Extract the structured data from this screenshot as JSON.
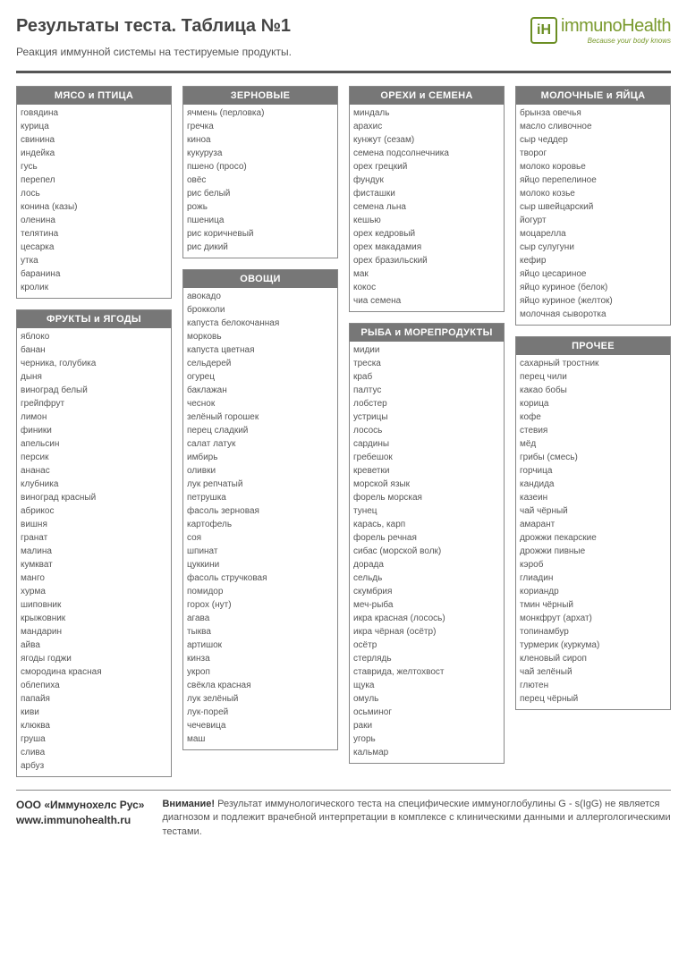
{
  "header": {
    "title": "Результаты теста. Таблица №1",
    "subtitle": "Реакция иммунной системы на тестируемые продукты."
  },
  "logo": {
    "name": "immunoHealth",
    "tagline": "Because your body knows"
  },
  "categories": {
    "meat": {
      "title": "МЯСО и ПТИЦА",
      "items": [
        "говядина",
        "курица",
        "свинина",
        "индейка",
        "гусь",
        "перепел",
        "лось",
        "конина (казы)",
        "оленина",
        "телятина",
        "цесарка",
        "утка",
        "баранина",
        "кролик"
      ]
    },
    "fruits": {
      "title": "ФРУКТЫ и ЯГОДЫ",
      "items": [
        "яблоко",
        "банан",
        "черника, голубика",
        "дыня",
        "виноград белый",
        "грейпфрут",
        "лимон",
        "финики",
        "апельсин",
        "персик",
        "ананас",
        "клубника",
        "виноград красный",
        "абрикос",
        "вишня",
        "гранат",
        "малина",
        "кумкват",
        "манго",
        "хурма",
        "шиповник",
        "крыжовник",
        "мандарин",
        "айва",
        "ягоды годжи",
        "смородина красная",
        "облепиха",
        "папайя",
        "киви",
        "клюква",
        "груша",
        "слива",
        "арбуз"
      ]
    },
    "grains": {
      "title": "ЗЕРНОВЫЕ",
      "items": [
        "ячмень (перловка)",
        "гречка",
        "киноа",
        "кукуруза",
        "пшено (просо)",
        "овёс",
        "рис белый",
        "рожь",
        "пшеница",
        "рис коричневый",
        "рис дикий"
      ]
    },
    "veg": {
      "title": "ОВОЩИ",
      "items": [
        "авокадо",
        "брокколи",
        "капуста белокочанная",
        "морковь",
        "капуста цветная",
        "сельдерей",
        "огурец",
        "баклажан",
        "чеснок",
        "зелёный горошек",
        "перец сладкий",
        "салат латук",
        "имбирь",
        "оливки",
        "лук репчатый",
        "петрушка",
        "фасоль зерновая",
        "картофель",
        "соя",
        "шпинат",
        "цуккини",
        "фасоль стручковая",
        "помидор",
        "горох (нут)",
        "агава",
        "тыква",
        "артишок",
        "кинза",
        "укроп",
        "свёкла красная",
        "лук зелёный",
        "лук-порей",
        "чечевица",
        "маш"
      ]
    },
    "nuts": {
      "title": "ОРЕХИ и СЕМЕНА",
      "items": [
        "миндаль",
        "арахис",
        "кунжут (сезам)",
        "семена подсолнечника",
        "орех грецкий",
        "фундук",
        "фисташки",
        "семена льна",
        "кешью",
        "орех кедровый",
        "орех макадамия",
        "орех бразильский",
        "мак",
        "кокос",
        "чиа семена"
      ]
    },
    "fish": {
      "title": "РЫБА и МОРЕПРОДУКТЫ",
      "items": [
        "мидии",
        "треска",
        "краб",
        "палтус",
        "лобстер",
        "устрицы",
        "лосось",
        "сардины",
        "гребешок",
        "креветки",
        "морской язык",
        "форель морская",
        "тунец",
        "карась, карп",
        "форель речная",
        "сибас (морской волк)",
        "дорада",
        "сельдь",
        "скумбрия",
        "меч-рыба",
        "икра красная (лосось)",
        "икра чёрная (осётр)",
        "осётр",
        "стерлядь",
        "ставрида, желтохвост",
        "щука",
        "омуль",
        "осьминог",
        "раки",
        "угорь",
        "кальмар"
      ]
    },
    "dairy": {
      "title": "МОЛОЧНЫЕ и ЯЙЦА",
      "items": [
        "брынза овечья",
        "масло сливочное",
        "сыр чеддер",
        "творог",
        "молоко коровье",
        "яйцо перепелиное",
        "молоко козье",
        "сыр швейцарский",
        "йогурт",
        "моцарелла",
        "сыр сулугуни",
        "кефир",
        "яйцо цесариное",
        "яйцо куриное (белок)",
        "яйцо куриное (желток)",
        "молочная сыворотка"
      ]
    },
    "other": {
      "title": "ПРОЧЕЕ",
      "items": [
        "сахарный тростник",
        "перец чили",
        "какао бобы",
        "корица",
        "кофе",
        "стевия",
        "мёд",
        "грибы (смесь)",
        "горчица",
        "кандида",
        "казеин",
        "чай чёрный",
        "амарант",
        "дрожжи пекарские",
        "дрожжи пивные",
        "кэроб",
        "глиадин",
        "кориандр",
        "тмин чёрный",
        "монкфрут (архат)",
        "топинамбур",
        "турмерик (куркума)",
        "кленовый сироп",
        "чай зелёный",
        "глютен",
        "перец чёрный"
      ]
    }
  },
  "footer": {
    "company": "ООО «Иммунохелс Рус»",
    "website": "www.immunohealth.ru",
    "warning_label": "Внимание!",
    "warning_text": " Результат иммунологического теста на специфические иммуноглобулины G - s(IgG) не является диагнозом и подлежит врачебной интерпретации в комплексе с клиническими данными и аллергологическими тестами."
  }
}
